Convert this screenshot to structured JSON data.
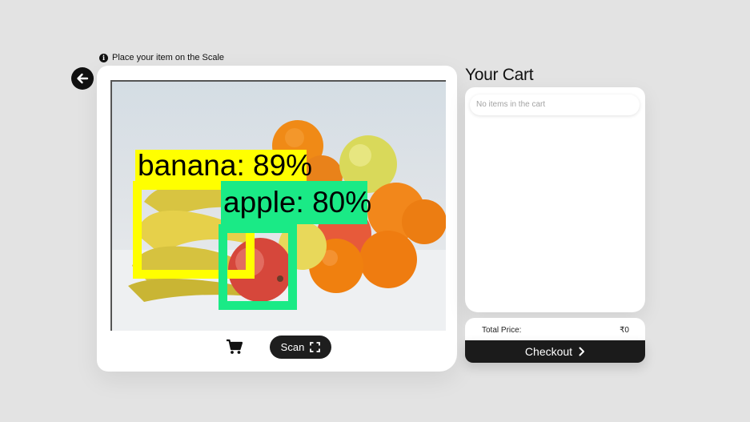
{
  "scanner": {
    "hint_text": "Place your item on the Scale",
    "scan_label": "Scan",
    "detections": [
      {
        "label": "banana: 89%",
        "color": "#ffff00"
      },
      {
        "label": "apple: 80%",
        "color": "#1aea86"
      }
    ]
  },
  "cart": {
    "title": "Your Cart",
    "empty_message": "No items in the cart",
    "total_label": "Total Price:",
    "total_value": "₹0",
    "checkout_label": "Checkout"
  },
  "colors": {
    "background": "#e3e3e3",
    "dark": "#1b1b1b",
    "banana_box": "#ffff00",
    "apple_box": "#1aea86"
  },
  "icons": {
    "back": "arrow-left-icon",
    "info": "info-icon",
    "cart": "shopping-cart-icon",
    "scan": "scan-frame-icon",
    "checkout": "chevron-right-icon"
  }
}
